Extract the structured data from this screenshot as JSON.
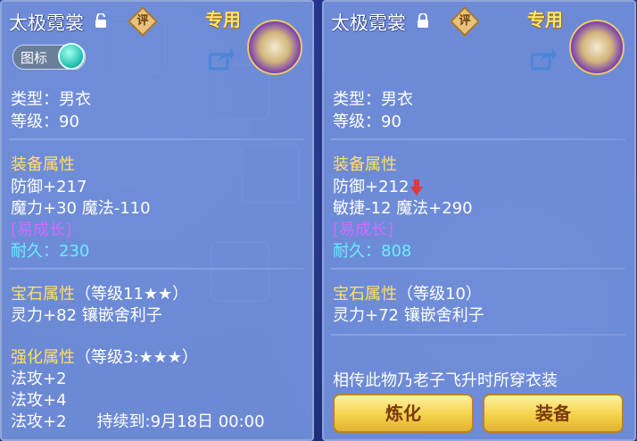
{
  "left": {
    "title": "太极霓裳",
    "badge": "评",
    "special": "专用",
    "toggle_label": "图标",
    "type_line": "类型：男衣",
    "level_line": "等级：90",
    "equip_attr_header": "装备属性",
    "defense": "防御+217",
    "magic_line": "魔力+30 魔法-110",
    "growth": "[易成长]",
    "durability_label": "耐久：",
    "durability_value": "230",
    "gem_header": "宝石属性",
    "gem_level": "（等级11★★）",
    "gem_effect": "灵力+82 镶嵌舍利子",
    "enhance_header": "强化属性",
    "enhance_level": "（等级3:★★★）",
    "enh1": "法攻+2",
    "enh2": "法攻+4",
    "enh3": "法攻+2",
    "enh3_duration": "持续到:9月18日 00:00"
  },
  "right": {
    "title": "太极霓裳",
    "badge": "评",
    "special": "专用",
    "type_line": "类型：男衣",
    "level_line": "等级：90",
    "equip_attr_header": "装备属性",
    "defense": "防御+212",
    "agility_line": "敏捷-12 魔法+290",
    "growth": "[易成长]",
    "durability_label": "耐久：",
    "durability_value": "808",
    "gem_header": "宝石属性",
    "gem_level": "（等级10）",
    "gem_effect": "灵力+72 镶嵌舍利子",
    "lore": "相传此物乃老子飞升时所穿衣装",
    "btn_refine": "炼化",
    "btn_equip": "装备"
  },
  "colors": {
    "section_yellow": "#ffe065",
    "growth_purple": "#d06bff",
    "durability_cyan": "#65f0ff",
    "button_gold": "#f5d24a",
    "down_arrow_red": "#e0393b"
  },
  "icons": [
    "unlocked-lock-icon",
    "locked-lock-icon",
    "rate-badge-icon",
    "share-icon",
    "character-portrait-icon",
    "down-arrow-icon"
  ]
}
